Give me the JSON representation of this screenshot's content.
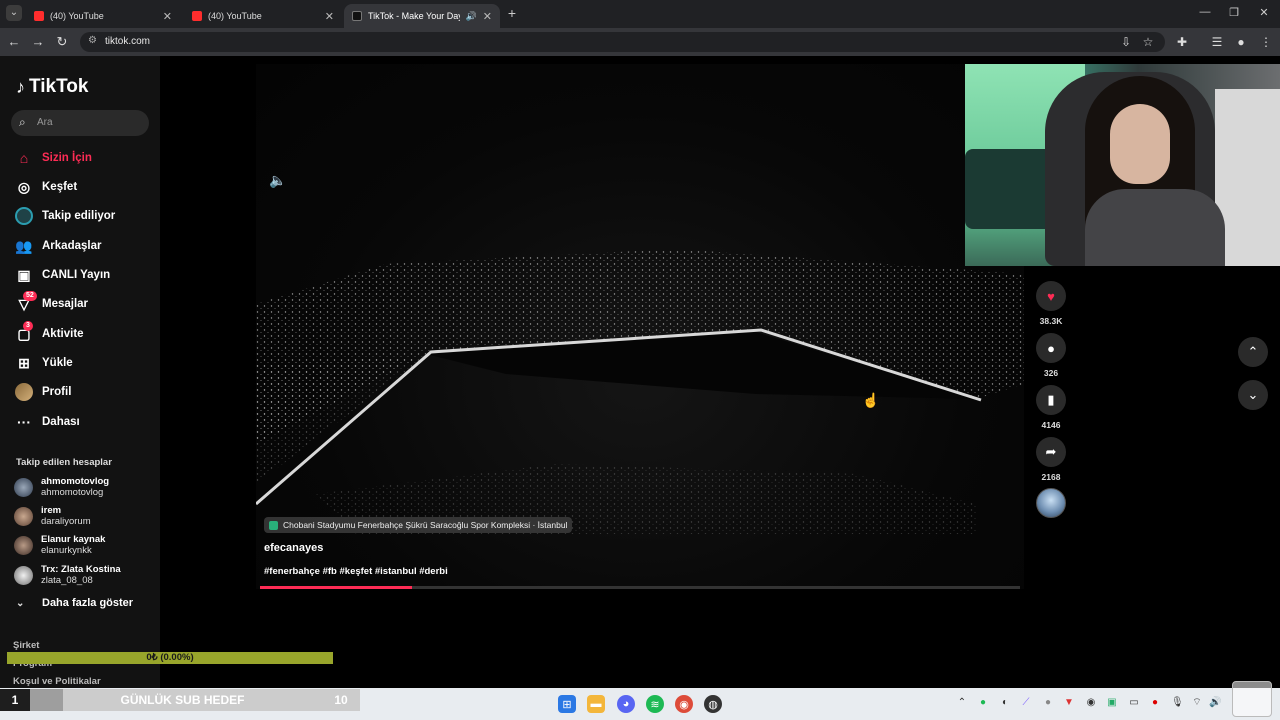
{
  "browser": {
    "tabs": [
      {
        "label": "(40) YouTube",
        "favicon": "youtube-icon",
        "active": false
      },
      {
        "label": "(40) YouTube",
        "favicon": "youtube-icon",
        "active": false
      },
      {
        "label": "TikTok - Make Your Day",
        "favicon": "tiktok-icon",
        "active": true
      }
    ],
    "url": "tiktok.com"
  },
  "tiktok": {
    "logo": "TikTok",
    "search_placeholder": "Ara",
    "nav": [
      {
        "label": "Sizin İçin",
        "icon": "home-icon",
        "active": true
      },
      {
        "label": "Keşfet",
        "icon": "compass-icon"
      },
      {
        "label": "Takip ediliyor",
        "icon": "following-avatar-icon"
      },
      {
        "label": "Arkadaşlar",
        "icon": "friends-icon"
      },
      {
        "label": "CANLI Yayın",
        "icon": "live-icon"
      },
      {
        "label": "Mesajlar",
        "icon": "message-icon",
        "badge": "52"
      },
      {
        "label": "Aktivite",
        "icon": "activity-icon",
        "badge": "3"
      },
      {
        "label": "Yükle",
        "icon": "upload-icon"
      },
      {
        "label": "Profil",
        "icon": "profile-avatar-icon"
      },
      {
        "label": "Dahası",
        "icon": "more-icon"
      }
    ],
    "following_title": "Takip edilen hesaplar",
    "following_accounts": [
      {
        "name": "ahmomotovlog",
        "handle": "ahmomotovlog"
      },
      {
        "name": "irem",
        "handle": "daraliyorum"
      },
      {
        "name": "Elanur kaynak",
        "handle": "elanurkynkk"
      },
      {
        "name": "Trx: Zlata Kostina",
        "handle": "zlata_08_08"
      }
    ],
    "show_more": "Daha fazla göster",
    "footer_links": [
      "Şirket",
      "Program",
      "Koşul ve Politikalar"
    ],
    "video": {
      "location": "Chobani Stadyumu Fenerbahçe Şükrü Saracoğlu Spor Kompleksi · İstanbul",
      "username": "efecanayes",
      "hashtags": "#fenerbahçe #fb #keşfet #istanbul #derbi",
      "progress_fraction": 0.2
    },
    "actions": {
      "likes": "38.3K",
      "comments": "326",
      "saves": "4146",
      "shares": "2168"
    }
  },
  "stream_overlay": {
    "goal_text": "0₺ (0.00%)",
    "sub_goal_count": "1",
    "sub_goal_label": "GÜNLÜK SUB HEDEF",
    "sub_goal_target": "10",
    "sub_goal_fraction": 0.1
  },
  "colors": {
    "tiktok_accent": "#fe2c55",
    "goal_bar": "#98a52b"
  }
}
